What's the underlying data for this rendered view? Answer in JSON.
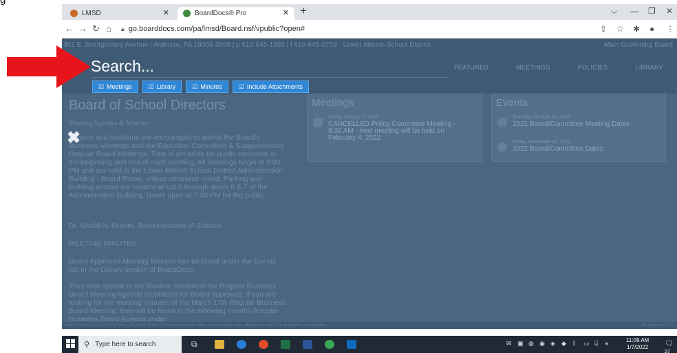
{
  "doc_fragment": "g",
  "browser": {
    "tabs": [
      {
        "label": "LMSD",
        "active": false
      },
      {
        "label": "BoardDocs® Pro",
        "active": true
      }
    ],
    "new_tab": "+",
    "url": "go.boarddocs.com/pa/lmsd/Board.nsf/vpublic?open#",
    "nav_icons": [
      "back-icon",
      "forward-icon",
      "reload-icon",
      "home-icon"
    ]
  },
  "header": {
    "address_line": "301 E. Montgomery Avenue | Ardmore, PA 19003-3399 | p 610-645-1930 | f 610-645-0703 - Lower Merion School District",
    "right_text": "Main Governing Board",
    "search_placeholder": "Search...",
    "filters": [
      "Meetings",
      "Library",
      "Minutes",
      "Include Attachments"
    ],
    "nav": [
      "FEATURED",
      "MEETINGS",
      "POLICIES",
      "LIBRARY"
    ]
  },
  "main": {
    "title": "Board of School Directors",
    "subtitle": "Meeting Agendas & Minutes",
    "paragraph1": "Parents and residents are encouraged to attend the Board's Business Meetings and the Education Committee & Supplementary Regular Board Meetings. Time is set aside for public comment at the beginning and end of each meeting. All meetings begin at 8:00 PM and are held in the Lower Merion School District Administration Building - Board Room, unless otherwise noted. Parking and building access are located at Lot 6 through doors 6 & 7 of the Administration Building. Doors open at 7:30 PM for the public.",
    "superintendent": "Dr. Khalid N. Mumin, Superintendent of Schools",
    "minutes_heading": "MEETING MINUTES",
    "paragraph2": "Board Approved Meeting Minutes can be found under the Events tab in the Library section of BoardDocs.",
    "paragraph3": "They also appear in the Routine Section of the Regular Business Board Meeting Agenda (submitted for Board approval). If you are looking for the meeting minutes of the March 17th Regular Business Board Meeting, they will be found in the following months Regular Business Board Agenda under"
  },
  "meetings": {
    "heading": "Meetings",
    "items": [
      {
        "date": "Friday, January 7, 2022",
        "title_lines": [
          "CANCELLED Policy Committee Meeting -",
          "8:30 AM - next meeting will be held on",
          "February 4, 2022"
        ]
      }
    ]
  },
  "events": {
    "heading": "Events",
    "items": [
      {
        "date": "Tuesday, October 20, 2020",
        "title": "2021 Board/Committee Meeting Dates"
      },
      {
        "date": "Friday, December 10, 2021",
        "title": "2022 Board/Committee Dates"
      }
    ]
  },
  "footer": {
    "left": "Lower Merion School District does not discriminate on the basis of race, color, national origin, sex, disability or age in its programs and activities.",
    "right": "BoardDocs® Pro"
  },
  "taskbar": {
    "search_placeholder": "Type here to search",
    "time": "11:09 AM",
    "date": "1/7/2022",
    "notif_count": "27"
  },
  "colors": {
    "overlay": "#4b6680",
    "chip": "#2f87d6",
    "arrow": "#e8141b"
  }
}
